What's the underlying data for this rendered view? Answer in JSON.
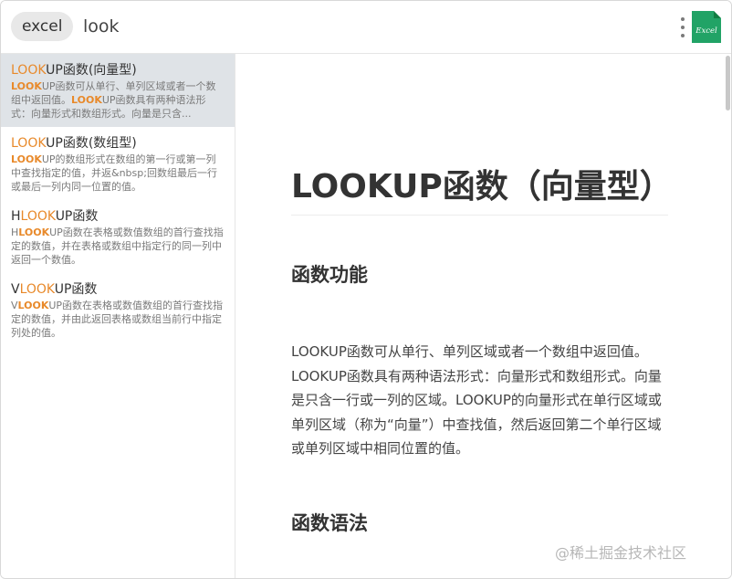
{
  "header": {
    "tag": "excel",
    "query": "look",
    "app_icon_label": "Excel"
  },
  "results": [
    {
      "title_hl": "LOOK",
      "title_rest": "UP函数(向量型)",
      "desc_hl1": "LOOK",
      "desc_mid": "UP函数可从单行、单列区域或者一个数组中返回值。",
      "desc_hl2": "LOOK",
      "desc_end": "UP函数具有两种语法形式：向量形式和数组形式。向量是只含..."
    },
    {
      "title_hl": "LOOK",
      "title_rest": "UP函数(数组型)",
      "desc_hl": "LOOK",
      "desc_end": "UP的数组形式在数组的第一行或第一列中查找指定的值，并返&nbsp;回数组最后一行或最后一列内同一位置的值。"
    },
    {
      "title_pre": "H",
      "title_hl": "LOOK",
      "title_rest": "UP函数",
      "desc_pre": "H",
      "desc_hl": "LOOK",
      "desc_end": "UP函数在表格或数值数组的首行查找指定的数值，并在表格或数组中指定行的同一列中返回一个数值。"
    },
    {
      "title_pre": "V",
      "title_hl": "LOOK",
      "title_rest": "UP函数",
      "desc_pre": "V",
      "desc_hl": "LOOK",
      "desc_end": "UP函数在表格或数值数组的首行查找指定的数值，并由此返回表格或数组当前行中指定列处的值。"
    }
  ],
  "article": {
    "title": "LOOKUP函数（向量型）",
    "section1": "函数功能",
    "paragraph": "LOOKUP函数可从单行、单列区域或者一个数组中返回值。LOOKUP函数具有两种语法形式：向量形式和数组形式。向量是只含一行或一列的区域。LOOKUP的向量形式在单行区域或单列区域（称为“向量”）中查找值，然后返回第二个单行区域或单列区域中相同位置的值。",
    "section2": "函数语法"
  },
  "watermark": "@稀土掘金技术社区",
  "colors": {
    "highlight": "#e8892a",
    "selected_bg": "#dfe3e7",
    "excel_green": "#21a366"
  },
  "icons": {
    "more": "vertical-ellipsis-icon",
    "app": "excel-app-icon"
  }
}
